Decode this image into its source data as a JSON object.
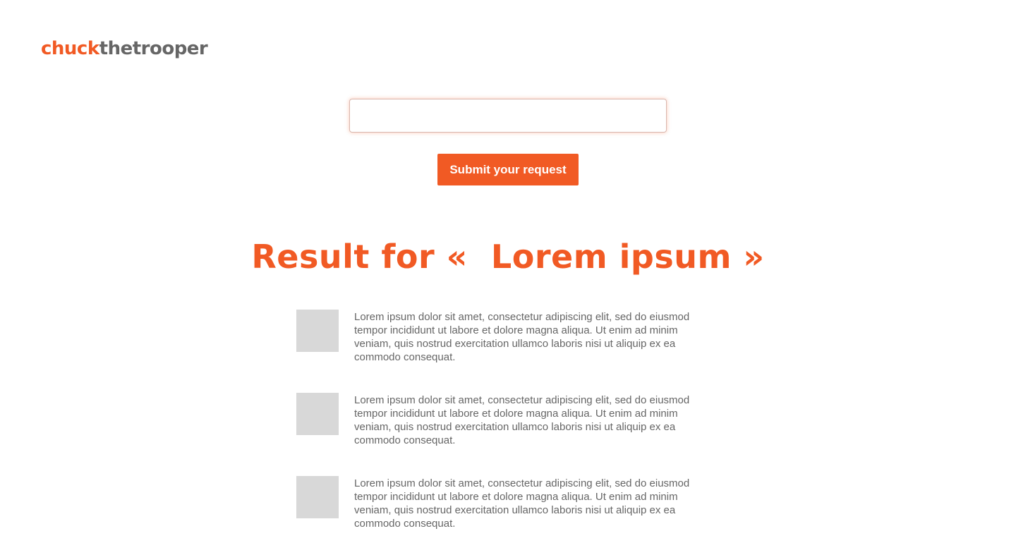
{
  "header": {
    "logo_part1": "chuck",
    "logo_part2": "thetrooper"
  },
  "search": {
    "value": "",
    "submit_label": "Submit your request"
  },
  "results": {
    "heading": "Result for «  Lorem ipsum »",
    "items": [
      {
        "text": "Lorem ipsum dolor sit amet, consectetur adipiscing elit, sed do eiusmod tempor incididunt ut labore et dolore magna aliqua. Ut enim ad minim veniam, quis nostrud exercitation ullamco laboris nisi ut aliquip ex ea commodo consequat."
      },
      {
        "text": "Lorem ipsum dolor sit amet, consectetur adipiscing elit, sed do eiusmod tempor incididunt ut labore et dolore magna aliqua. Ut enim ad minim veniam, quis nostrud exercitation ullamco laboris nisi ut aliquip ex ea commodo consequat."
      },
      {
        "text": "Lorem ipsum dolor sit amet, consectetur adipiscing elit, sed do eiusmod tempor incididunt ut labore et dolore magna aliqua. Ut enim ad minim veniam, quis nostrud exercitation ullamco laboris nisi ut aliquip ex ea commodo consequat."
      }
    ]
  },
  "colors": {
    "accent": "#f15a24",
    "text_gray": "#666666",
    "thumb_gray": "#d8d8d8"
  }
}
